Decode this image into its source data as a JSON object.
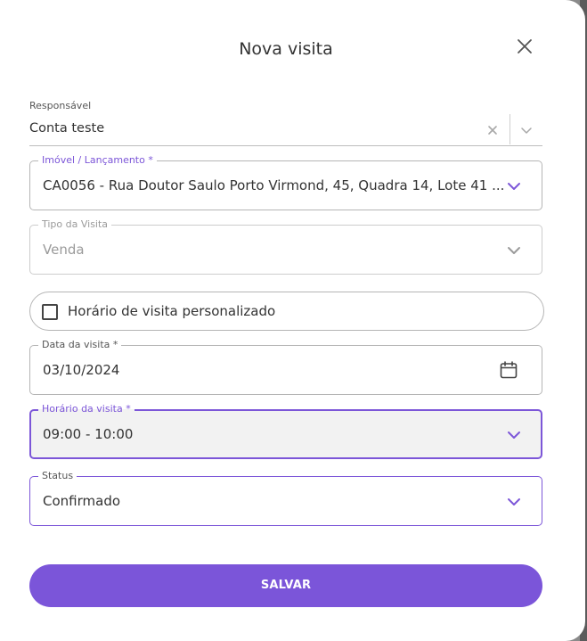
{
  "modal": {
    "title": "Nova visita"
  },
  "form": {
    "responsavel": {
      "label": "Responsável",
      "value": "Conta teste"
    },
    "imovel": {
      "label": "Imóvel / Lançamento *",
      "value": "CA0056 - Rua Doutor Saulo Porto Virmond, 45, Quadra 14, Lote 41 ..."
    },
    "tipo_visita": {
      "label": "Tipo da Visita",
      "value": "Venda"
    },
    "horario_personalizado": {
      "label": "Horário de visita personalizado",
      "checked": false
    },
    "data_visita": {
      "label": "Data da visita *",
      "value": "03/10/2024"
    },
    "horario_visita": {
      "label": "Horário da visita *",
      "value": "09:00 - 10:00"
    },
    "status": {
      "label": "Status",
      "value": "Confirmado"
    }
  },
  "actions": {
    "save_label": "SALVAR"
  },
  "icons": {
    "close": "close-icon",
    "clear": "clear-icon",
    "chevron": "chevron-down-icon",
    "calendar": "calendar-icon"
  },
  "colors": {
    "accent": "#7b55d9",
    "text": "#333333",
    "border": "#b5b5b5",
    "disabled_text": "#9a9a9a",
    "focused_bg": "#f2f2f2"
  }
}
